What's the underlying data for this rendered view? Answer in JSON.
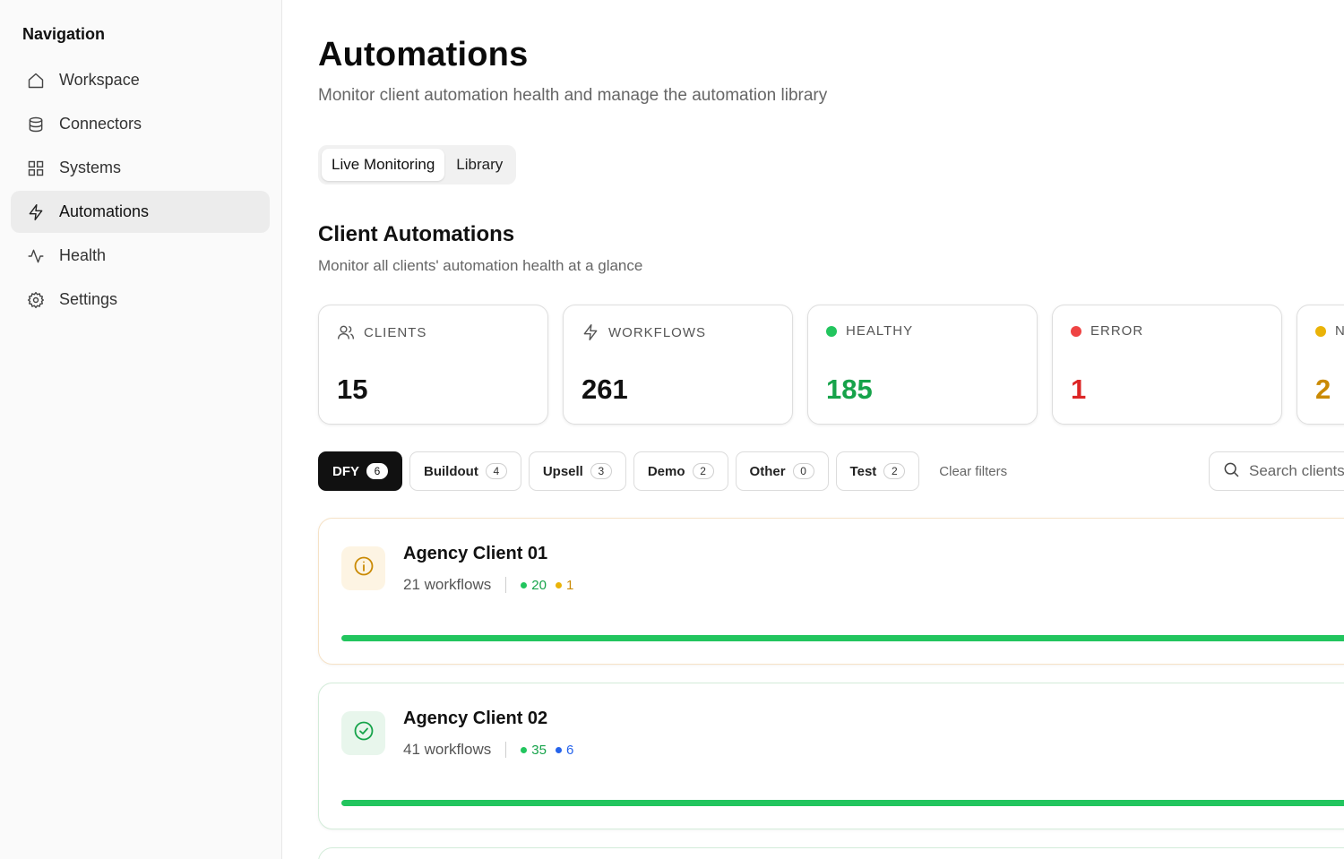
{
  "sidebar": {
    "heading": "Navigation",
    "items": [
      {
        "label": "Workspace"
      },
      {
        "label": "Connectors"
      },
      {
        "label": "Systems"
      },
      {
        "label": "Automations",
        "active": true
      },
      {
        "label": "Health"
      },
      {
        "label": "Settings"
      }
    ]
  },
  "page": {
    "title": "Automations",
    "subtitle": "Monitor client automation health and manage the automation library"
  },
  "tabs": [
    {
      "label": "Live Monitoring",
      "active": true
    },
    {
      "label": "Library"
    }
  ],
  "section": {
    "title": "Client Automations",
    "subtitle": "Monitor all clients' automation health at a glance"
  },
  "stats": [
    {
      "label": "CLIENTS",
      "value": "15",
      "icon": "users-icon",
      "color": "#111111"
    },
    {
      "label": "WORKFLOWS",
      "value": "261",
      "icon": "bolt-icon",
      "color": "#111111"
    },
    {
      "label": "HEALTHY",
      "value": "185",
      "dot": "#22c55e",
      "color": "#16a34a"
    },
    {
      "label": "ERROR",
      "value": "1",
      "dot": "#ef4444",
      "color": "#dc2626"
    },
    {
      "label": "N",
      "value": "2",
      "dot": "#eab308",
      "color": "#ca8a04"
    }
  ],
  "filters": [
    {
      "label": "DFY",
      "count": "6",
      "active": true
    },
    {
      "label": "Buildout",
      "count": "4"
    },
    {
      "label": "Upsell",
      "count": "3"
    },
    {
      "label": "Demo",
      "count": "2"
    },
    {
      "label": "Other",
      "count": "0"
    },
    {
      "label": "Test",
      "count": "2"
    }
  ],
  "clear_filters": "Clear filters",
  "search": {
    "placeholder": "Search clients"
  },
  "clients": [
    {
      "name": "Agency Client 01",
      "workflows": "21 workflows",
      "status": "warning",
      "badges": [
        {
          "value": "20",
          "color": "#16a34a"
        },
        {
          "value": "1",
          "color": "#ca8a04"
        }
      ],
      "progress": {
        "healthy_fraction": 1.0,
        "other_fraction": 0.0,
        "other_color": "#eab308"
      }
    },
    {
      "name": "Agency Client 02",
      "workflows": "41 workflows",
      "status": "healthy",
      "badges": [
        {
          "value": "35",
          "color": "#16a34a"
        },
        {
          "value": "6",
          "color": "#2563eb"
        }
      ],
      "progress": {
        "healthy_fraction": 0.99,
        "other_fraction": 0.01,
        "other_color": "#2563eb"
      }
    }
  ],
  "colors": {
    "accent": "#111111",
    "healthy": "#22c55e",
    "warning": "#ca8a04",
    "error": "#dc2626",
    "info": "#2563eb"
  }
}
